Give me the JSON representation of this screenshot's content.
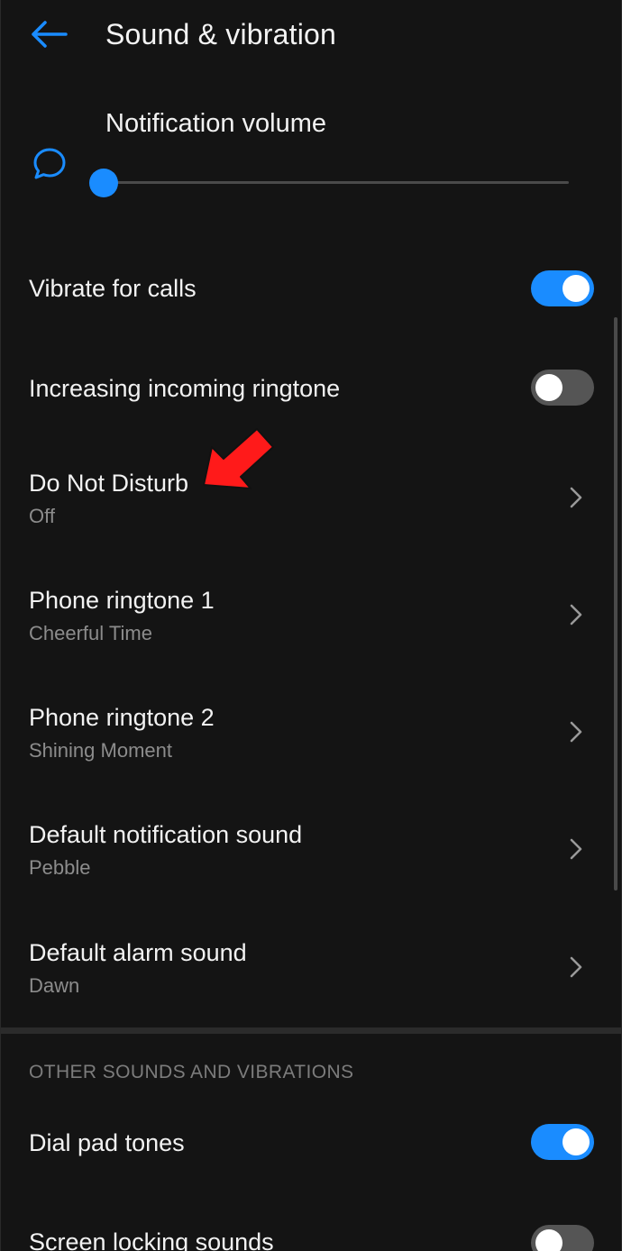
{
  "header": {
    "title": "Sound & vibration",
    "back_icon": "arrow-left-icon"
  },
  "volume": {
    "label": "Notification volume",
    "icon": "chat-bubble-icon",
    "level_fraction": 0.0
  },
  "settings": {
    "vibrate_calls": {
      "title": "Vibrate for calls",
      "enabled": true
    },
    "increasing_ringtone": {
      "title": "Increasing incoming ringtone",
      "enabled": false
    },
    "do_not_disturb": {
      "title": "Do Not Disturb",
      "value": "Off"
    },
    "ringtone_1": {
      "title": "Phone ringtone 1",
      "value": "Cheerful Time"
    },
    "ringtone_2": {
      "title": "Phone ringtone 2",
      "value": "Shining Moment"
    },
    "notification_sound": {
      "title": "Default notification sound",
      "value": "Pebble"
    },
    "alarm_sound": {
      "title": "Default alarm sound",
      "value": "Dawn"
    }
  },
  "other_section": {
    "header": "OTHER SOUNDS AND VIBRATIONS",
    "dial_pad_tones": {
      "title": "Dial pad tones",
      "enabled": true
    },
    "screen_locking_sounds": {
      "title": "Screen locking sounds",
      "enabled": false
    }
  },
  "colors": {
    "accent": "#1a8cff",
    "background": "#141414",
    "annotation": "#ff1a1a"
  }
}
